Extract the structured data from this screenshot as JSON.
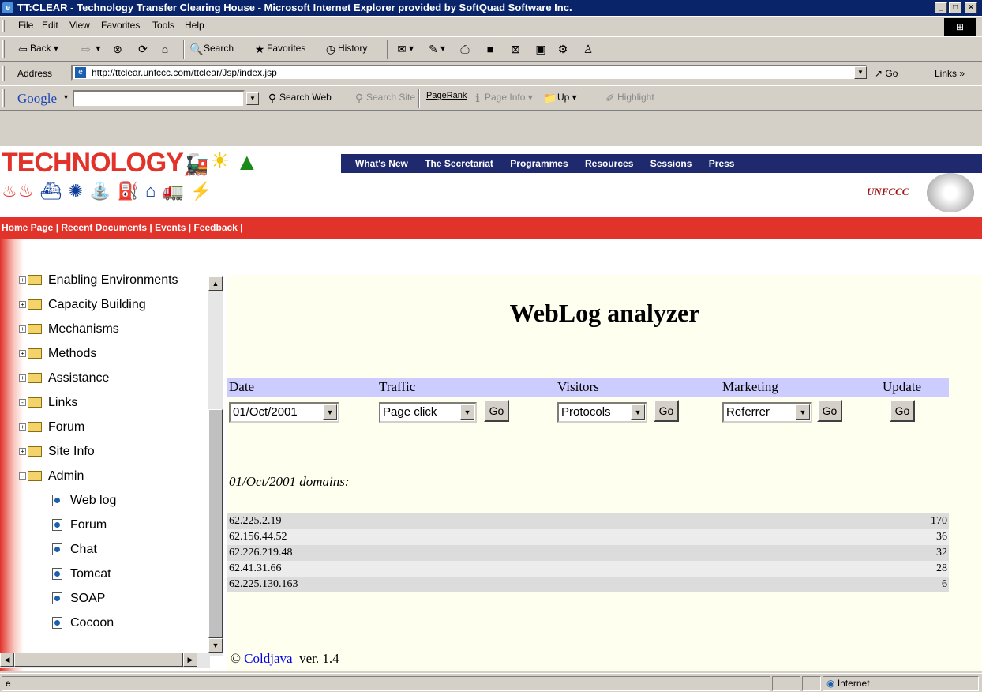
{
  "window": {
    "title": "TT:CLEAR - Technology Transfer Clearing House - Microsoft Internet Explorer provided by SoftQuad Software Inc.",
    "min": "_",
    "max": "□",
    "close": "×"
  },
  "menu": [
    "File",
    "Edit",
    "View",
    "Favorites",
    "Tools",
    "Help"
  ],
  "toolbar": {
    "back": "Back",
    "search": "Search",
    "favorites": "Favorites",
    "history": "History"
  },
  "address": {
    "label": "Address",
    "url": "http://ttclear.unfccc.com/ttclear/Jsp/index.jsp",
    "go": "Go",
    "links": "Links"
  },
  "google": {
    "logo": "Google",
    "search_web": "Search Web",
    "search_site": "Search Site",
    "pagerank": "PageRank",
    "page_info": "Page Info",
    "up": "Up",
    "highlight": "Highlight"
  },
  "banner": {
    "logo": "TECHNOLOGY",
    "unfccc": "UNFCCC"
  },
  "nav": [
    "What's New",
    "The Secretariat",
    "Programmes",
    "Resources",
    "Sessions",
    "Press"
  ],
  "subnav": "Home Page  | Recent Documents  | Events  | Feedback  |",
  "tree": {
    "folders": [
      {
        "label": "Enabling Environments",
        "pm": "+"
      },
      {
        "label": "Capacity Building",
        "pm": "+"
      },
      {
        "label": "Mechanisms",
        "pm": "+"
      },
      {
        "label": "Methods",
        "pm": "+"
      },
      {
        "label": "Assistance",
        "pm": "+"
      },
      {
        "label": "Links",
        "pm": "-"
      },
      {
        "label": "Forum",
        "pm": "+"
      },
      {
        "label": "Site Info",
        "pm": "+"
      },
      {
        "label": "Admin",
        "pm": "-"
      }
    ],
    "leaves": [
      "Web log",
      "Forum",
      "Chat",
      "Tomcat",
      "SOAP",
      "Cocoon"
    ]
  },
  "content": {
    "title": "WebLog analyzer",
    "headers": {
      "date": "Date",
      "traffic": "Traffic",
      "visitors": "Visitors",
      "marketing": "Marketing",
      "update": "Update"
    },
    "selects": {
      "date": "01/Oct/2001",
      "traffic": "Page click",
      "visitors": "Protocols",
      "marketing": "Referrer"
    },
    "go": "Go",
    "domains_title": "01/Oct/2001 domains:",
    "rows": [
      {
        "ip": "62.225.2.19",
        "count": "170"
      },
      {
        "ip": "62.156.44.52",
        "count": "36"
      },
      {
        "ip": "62.226.219.48",
        "count": "32"
      },
      {
        "ip": "62.41.31.66",
        "count": "28"
      },
      {
        "ip": "62.225.130.163",
        "count": "6"
      }
    ],
    "footer_prefix": "©",
    "footer_link": "Coldjava",
    "footer_suffix": "ver. 1.4"
  },
  "status": {
    "zone": "Internet"
  }
}
